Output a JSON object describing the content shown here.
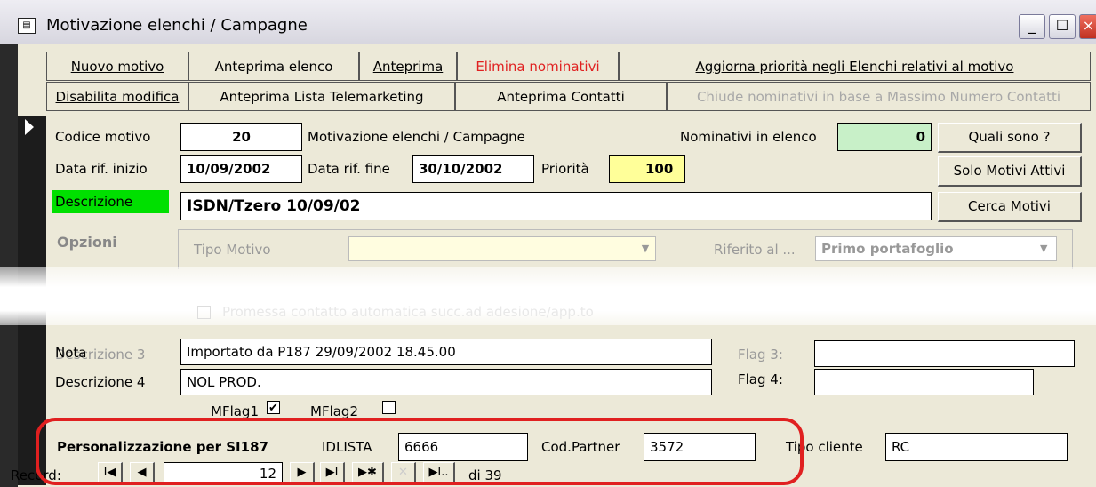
{
  "window": {
    "title": "Motivazione elenchi / Campagne",
    "minimize": "_",
    "maximize": "☐",
    "close": "×"
  },
  "commands_row1": [
    "Nuovo motivo",
    "Anteprima elenco",
    "Anteprima",
    "Elimina nominativi",
    "Aggiorna priorità negli Elenchi relativi al motivo"
  ],
  "commands_row2": [
    "Disabilita modifica",
    "Anteprima Lista Telemarketing",
    "Anteprima Contatti",
    "Chiude nominativi in base a Massimo Numero Contatti"
  ],
  "form": {
    "codice_label": "Codice motivo",
    "codice_value": "20",
    "motivazione_label": "Motivazione elenchi / Campagne",
    "nominativi_label": "Nominativi in elenco",
    "nominativi_value": "0",
    "quali_button": "Quali sono ?",
    "data_inizio_label": "Data rif. inizio",
    "data_inizio_value": "10/09/2002",
    "data_fine_label": "Data rif. fine",
    "data_fine_value": "30/10/2002",
    "priorita_label": "Priorità",
    "priorita_value": "100",
    "solo_attivi_button": "Solo Motivi Attivi",
    "descrizione_label": "Descrizione",
    "descrizione_value": "ISDN/Tzero 10/09/02",
    "cerca_button": "Cerca Motivi",
    "opzioni_label": "Opzioni",
    "tipo_motivo_label": "Tipo Motivo",
    "riferito_label": "Riferito al ...",
    "riferito_value": "Primo portafoglio",
    "promessa_label": "Promessa contatto automatica succ.ad adesione/app.to",
    "descrizione3_label": "Descrizione 3",
    "nota_label": "Nota",
    "nota_value": "Importato da P187 29/09/2002 18.45.00",
    "flag3_label": "Flag 3:",
    "descrizione4_label": "Descrizione 4",
    "descrizione4_value": "NOL PROD.",
    "flag4_label": "Flag 4:",
    "mflag1_label": "MFlag1",
    "mflag1_checked": "✔",
    "mflag2_label": "MFlag2"
  },
  "personalizzazione": {
    "title": "Personalizzazione per SI187",
    "idlista_label": "IDLISTA",
    "idlista_value": "6666",
    "partner_label": "Cod.Partner",
    "partner_value": "3572",
    "tipo_cliente_label": "Tipo cliente",
    "tipo_cliente_value": "RC"
  },
  "record_nav": {
    "label": "Record:",
    "current": "12",
    "total": "di 39",
    "first": "I◀",
    "prev": "◀",
    "next": "▶",
    "last": "▶I",
    "new": "▶✱",
    "delete": "✕",
    "end": "▶I.."
  }
}
